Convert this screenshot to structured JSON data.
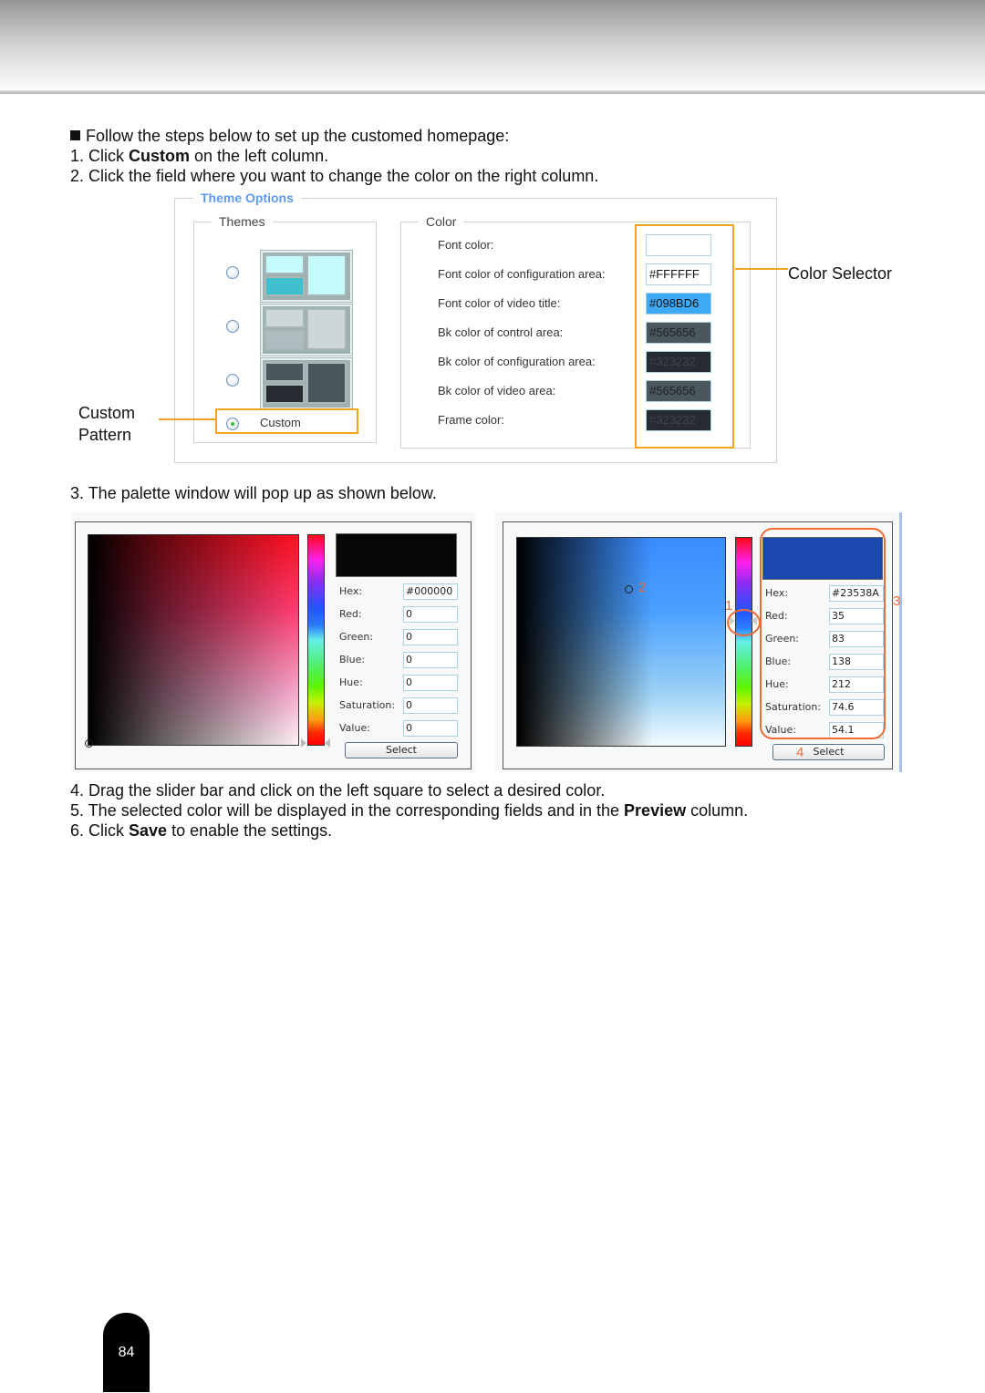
{
  "intro": {
    "bullet_text": "Follow the steps below to set up the customed homepage:",
    "step1": {
      "prefix": "1. Click ",
      "bold": "Custom",
      "suffix": " on the left column."
    },
    "step2": "2. Click the field where you want to change the color on the right column."
  },
  "theme_options": {
    "legend": "Theme Options",
    "themes": {
      "legend": "Themes",
      "items": [
        {
          "name": "theme-1",
          "colors": {
            "a": "#c4fbfd",
            "b": "#3fc0ce",
            "c": "#c4fbfd"
          },
          "checked": false
        },
        {
          "name": "theme-2",
          "colors": {
            "a": "#cdd7d8",
            "b": "#adbcbf",
            "c": "#cdd7d8"
          },
          "checked": false
        },
        {
          "name": "theme-3",
          "colors": {
            "a": "#4a575d",
            "b": "#262b31",
            "c": "#4a575d"
          },
          "checked": false
        }
      ],
      "custom_label": "Custom",
      "custom_checked": true
    },
    "color": {
      "legend": "Color",
      "fields": [
        {
          "label": "Font color:",
          "value": "",
          "bg": "#ffffff",
          "fg": "#111111"
        },
        {
          "label": "Font color of configuration area:",
          "value": "#FFFFFF",
          "bg": "#ffffff",
          "fg": "#111111"
        },
        {
          "label": "Font color of video title:",
          "value": "#098BD6",
          "bg": "#3ea9f5",
          "fg": "#111111"
        },
        {
          "label": "Bk color of control area:",
          "value": "#565656",
          "bg": "#4a575d",
          "fg": "#1c2226"
        },
        {
          "label": "Bk color of configuration area:",
          "value": "#323232",
          "bg": "#262b31",
          "fg": "#3b4248"
        },
        {
          "label": "Bk color of video area:",
          "value": "#565656",
          "bg": "#4a575d",
          "fg": "#1c2226"
        },
        {
          "label": "Frame color:",
          "value": "#323232",
          "bg": "#262b31",
          "fg": "#3b4248"
        }
      ]
    },
    "annotations": {
      "color_selector": "Color Selector",
      "custom_pattern_line1": "Custom",
      "custom_pattern_line2": "Pattern"
    },
    "accent_color": "#f5a21e"
  },
  "step3": "3. The palette window will pop up as shown below.",
  "palette_left": {
    "hue_color": "#ff1020",
    "preview_color": "#050707",
    "fields": [
      {
        "label": "Hex:",
        "value": "#000000"
      },
      {
        "label": "Red:",
        "value": "0"
      },
      {
        "label": "Green:",
        "value": "0"
      },
      {
        "label": "Blue:",
        "value": "0"
      },
      {
        "label": "Hue:",
        "value": "0"
      },
      {
        "label": "Saturation:",
        "value": "0"
      },
      {
        "label": "Value:",
        "value": "0"
      }
    ],
    "select_label": "Select"
  },
  "palette_right": {
    "hue_color": "#3a8cff",
    "preview_color": "#1c47ae",
    "fields": [
      {
        "label": "Hex:",
        "value": "#23538A"
      },
      {
        "label": "Red:",
        "value": "35"
      },
      {
        "label": "Green:",
        "value": "83"
      },
      {
        "label": "Blue:",
        "value": "138"
      },
      {
        "label": "Hue:",
        "value": "212"
      },
      {
        "label": "Saturation:",
        "value": "74.6"
      },
      {
        "label": "Value:",
        "value": "54.1"
      }
    ],
    "select_label": "Select",
    "callouts": [
      "1",
      "2",
      "3",
      "4"
    ],
    "callout_color": "#f26b35"
  },
  "steps_after": {
    "step4": "4. Drag the slider bar and click on the left square to select a desired color.",
    "step5": {
      "prefix": "5. The selected color will be displayed in the corresponding fields and in the ",
      "bold": "Preview",
      "suffix": " column."
    },
    "step6": {
      "prefix": "6. Click ",
      "bold": "Save",
      "suffix": " to enable the settings."
    }
  },
  "page_number": "84"
}
